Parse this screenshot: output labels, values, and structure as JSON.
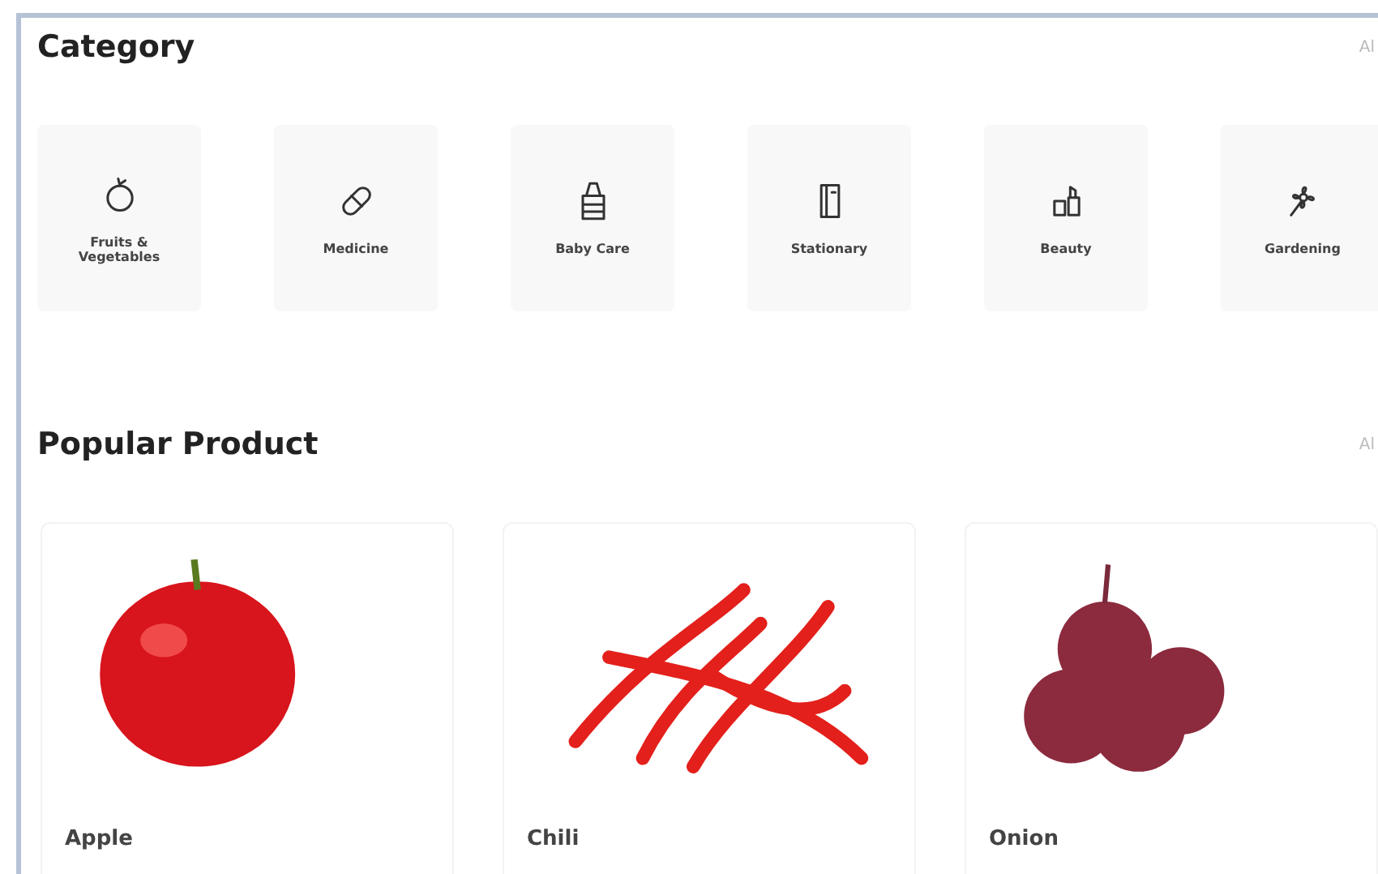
{
  "category": {
    "title": "Category",
    "view_all": "Al",
    "items": [
      {
        "label": "Fruits & Vegetables"
      },
      {
        "label": "Medicine"
      },
      {
        "label": "Baby Care"
      },
      {
        "label": "Stationary"
      },
      {
        "label": "Beauty"
      },
      {
        "label": "Gardening"
      }
    ]
  },
  "popular": {
    "title": "Popular Product",
    "view_all": "Al",
    "products": [
      {
        "name": "Apple"
      },
      {
        "name": "Chili"
      },
      {
        "name": "Onion"
      }
    ]
  }
}
